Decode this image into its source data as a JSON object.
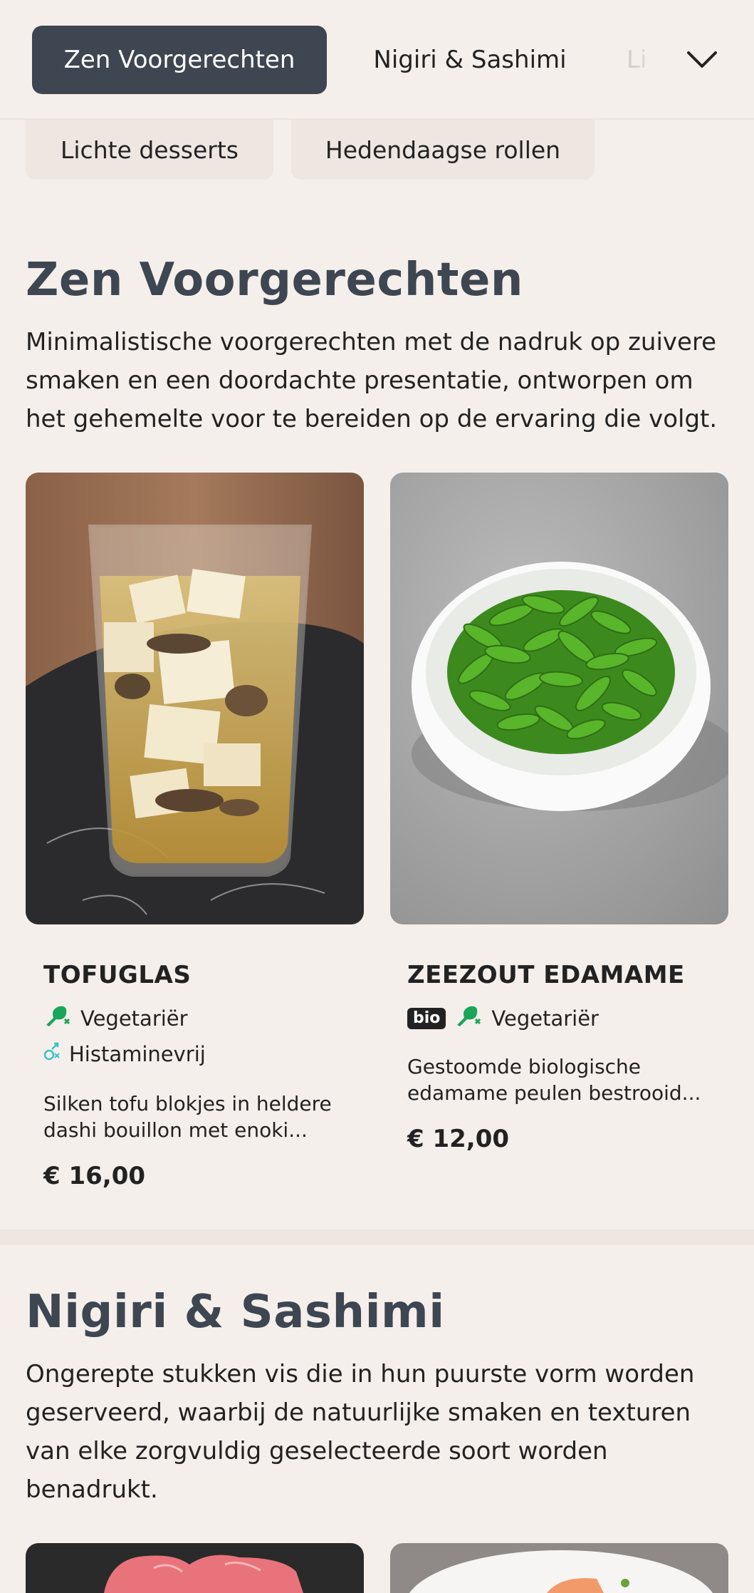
{
  "nav": {
    "tabs": [
      {
        "label": "Zen Voorgerechten",
        "active": true
      },
      {
        "label": "Nigiri & Sashimi",
        "active": false
      },
      {
        "label": "Lichte desserts",
        "active": false
      }
    ],
    "truncated_tab_text": "Li",
    "expand_icon": "chevron-down-icon",
    "chips": [
      "Lichte desserts",
      "Hedendaagse rollen"
    ]
  },
  "sections": [
    {
      "title": "Zen Voorgerechten",
      "description": "Minimalistische voorgerechten met de nadruk op zuivere smaken en een doordachte presentatie, ontworpen om het gehemelte voor te bereiden op de ervaring die volgt.",
      "items": [
        {
          "name": "TOFUGLAS",
          "tags": [
            {
              "icon": "leaf-drumstick-icon",
              "label": "Vegetariër"
            },
            {
              "icon": "histamine-free-icon",
              "label": "Histaminevrij"
            }
          ],
          "description": "Silken tofu blokjes in heldere dashi bouillon met enoki...",
          "price": "€ 16,00"
        },
        {
          "name": "ZEEZOUT EDAMAME",
          "badge": "bio",
          "tags": [
            {
              "icon": "leaf-drumstick-icon",
              "label": "Vegetariër"
            }
          ],
          "description": "Gestoomde biologische edamame peulen bestrooid...",
          "price": "€ 12,00"
        }
      ]
    },
    {
      "title": "Nigiri & Sashimi",
      "description": "Ongerepte stukken vis die in hun puurste vorm worden geserveerd, waarbij de natuurlijke smaken en texturen van elke zorgvuldig geselecteerde soort worden benadrukt."
    }
  ],
  "colors": {
    "background": "#f5efeb",
    "accent": "#3d4651",
    "tag_green": "#1aa55a",
    "histamine_teal": "#3cc0c8"
  }
}
